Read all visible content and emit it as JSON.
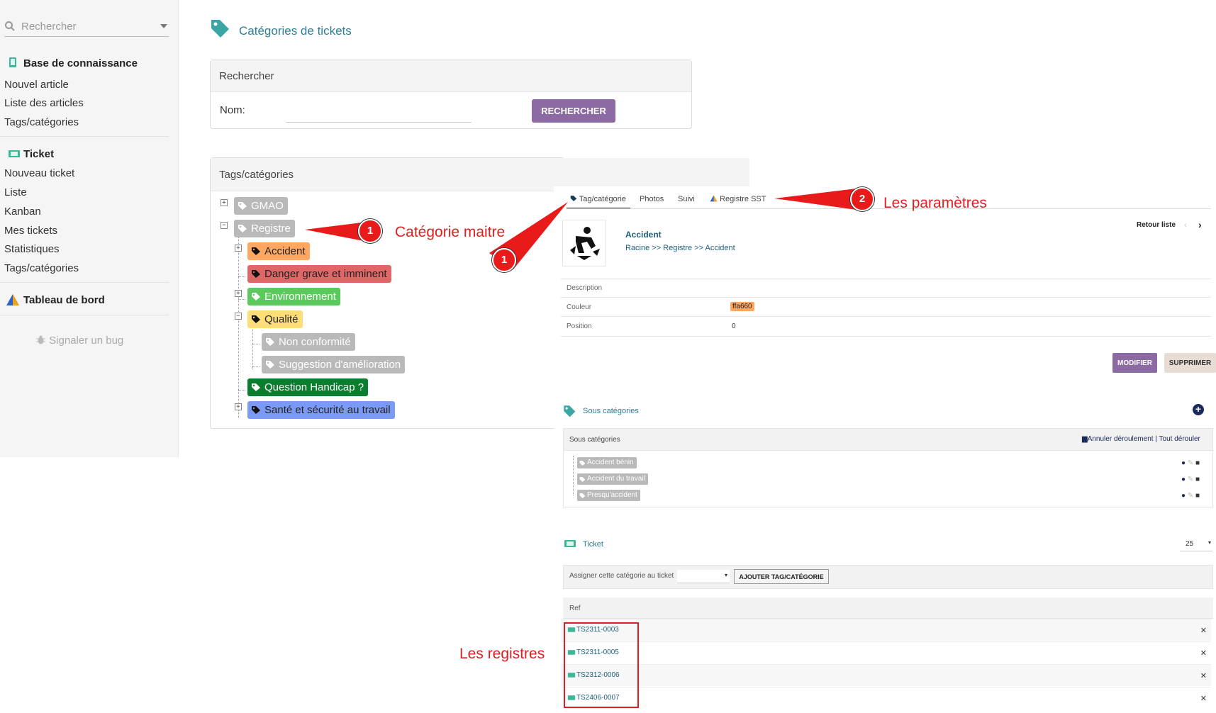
{
  "sidebar": {
    "search_placeholder": "Rechercher",
    "kb": {
      "title": "Base de connaissance",
      "items": [
        "Nouvel article",
        "Liste des articles",
        "Tags/catégories"
      ]
    },
    "ticket": {
      "title": "Ticket",
      "items": [
        "Nouveau ticket",
        "Liste",
        "Kanban",
        "Mes tickets",
        "Statistiques",
        "Tags/catégories"
      ]
    },
    "dashboard": {
      "title": "Tableau de bord"
    },
    "bug": "Signaler un bug"
  },
  "page": {
    "title": "Catégories de tickets",
    "search_panel": {
      "title": "Rechercher",
      "label": "Nom:",
      "button": "RECHERCHER"
    },
    "tree_panel": {
      "title": "Tags/catégories"
    }
  },
  "tree": {
    "gmao": {
      "label": "GMAO",
      "color": "#b9b9b9"
    },
    "registre": {
      "label": "Registre",
      "color": "#b9b9b9"
    },
    "accident": {
      "label": "Accident",
      "color": "#ffa660"
    },
    "danger": {
      "label": "Danger grave et imminent",
      "color": "#e06767"
    },
    "environnement": {
      "label": "Environnement",
      "color": "#5cc95c"
    },
    "qualite": {
      "label": "Qualité",
      "color": "#ffdd77"
    },
    "non_conformite": {
      "label": "Non conformité",
      "color": "#b9b9b9"
    },
    "suggestion": {
      "label": "Suggestion d'amélioration",
      "color": "#b9b9b9"
    },
    "handicap": {
      "label": "Question Handicap ?",
      "color": "#0a7d2e"
    },
    "sante": {
      "label": "Santé et sécurité au travail",
      "color": "#7b9af5"
    }
  },
  "annotations": {
    "cat_maitre": "Catégorie maitre",
    "parametres": "Les paramètres",
    "registres": "Les registres",
    "badge1": "1",
    "badge2": "2"
  },
  "detail": {
    "tabs": [
      "Tag/catégorie",
      "Photos",
      "Suivi",
      "Registre SST"
    ],
    "retour": "Retour liste",
    "name": "Accident",
    "breadcrumb": "Racine >> Registre >> Accident",
    "fields": {
      "description_label": "Description",
      "couleur_label": "Couleur",
      "couleur_value": "ffa660",
      "position_label": "Position",
      "position_value": "0"
    },
    "modifier": "MODIFIER",
    "supprimer": "SUPPRIMER",
    "sous_cat_title": "Sous catégories",
    "sous_cat_header": "Sous catégories",
    "sous_cat_actions": "Annuler déroulement | Tout dérouler",
    "sub_items": [
      "Accident bénin",
      "Accident du travail",
      "Presqu'accident"
    ],
    "ticket_title": "Ticket",
    "per_page": "25",
    "assign_label": "Assigner cette catégorie au ticket",
    "add_button": "AJOUTER TAG/CATÉGORIE",
    "ref_header": "Ref",
    "refs": [
      "TS2311-0003",
      "TS2311-0005",
      "TS2312-0006",
      "TS2406-0007"
    ]
  }
}
